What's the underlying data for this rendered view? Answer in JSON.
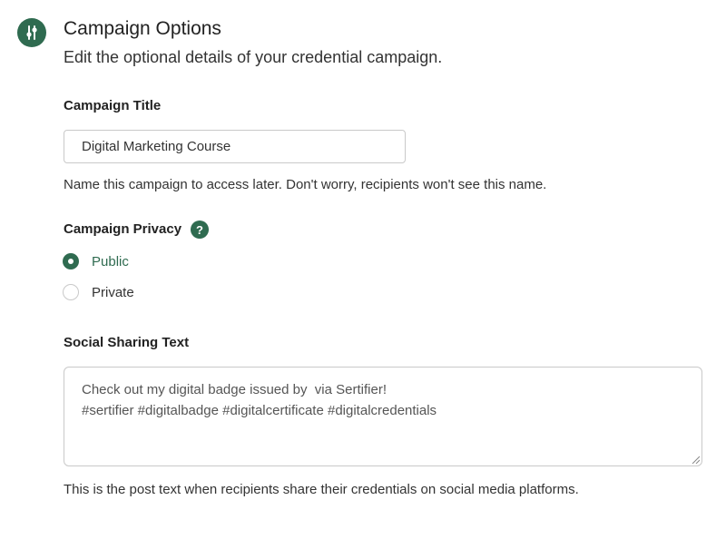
{
  "header": {
    "icon": "sliders-icon",
    "title": "Campaign Options",
    "subtitle": "Edit the optional details of your credential campaign."
  },
  "campaign_title": {
    "label": "Campaign Title",
    "value": "Digital Marketing Course",
    "help": "Name this campaign to access later. Don't worry, recipients won't see this name."
  },
  "privacy": {
    "label": "Campaign Privacy",
    "help_icon": "?",
    "options": [
      {
        "label": "Public",
        "selected": true
      },
      {
        "label": "Private",
        "selected": false
      }
    ]
  },
  "social": {
    "label": "Social Sharing Text",
    "lines": [
      "Check out my digital badge issued by  via Sertifier!",
      "#sertifier #digitalbadge #digitalcertificate #digitalcredentials"
    ],
    "help": "This is the post text when recipients share their credentials on social media platforms."
  },
  "colors": {
    "accent": "#2f6b50",
    "border": "#c9c9c9"
  }
}
